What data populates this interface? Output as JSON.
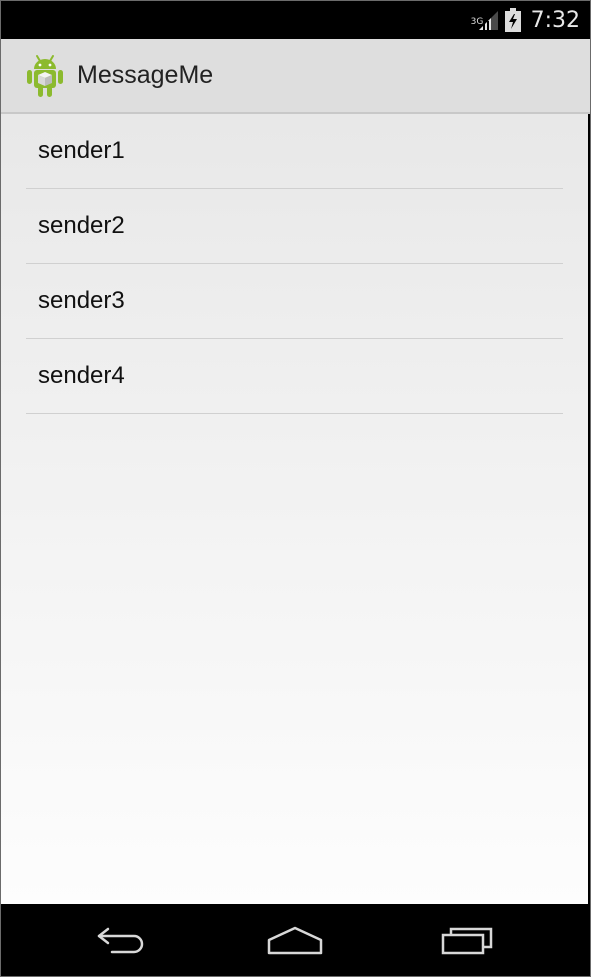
{
  "status_bar": {
    "network": "3G",
    "time": "7:32",
    "icons": [
      "signal-icon",
      "battery-charging-icon"
    ]
  },
  "action_bar": {
    "title": "MessageMe",
    "icon": "android-app-icon"
  },
  "senders": [
    {
      "label": "sender1"
    },
    {
      "label": "sender2"
    },
    {
      "label": "sender3"
    },
    {
      "label": "sender4"
    }
  ],
  "nav_bar": {
    "icons": [
      "back-icon",
      "home-icon",
      "recents-icon"
    ]
  },
  "colors": {
    "action_bar_bg": "#dedede",
    "content_gradient_top": "#e8e8e8",
    "content_gradient_bottom": "#fdfdfd",
    "android_green": "#8cba2e"
  }
}
